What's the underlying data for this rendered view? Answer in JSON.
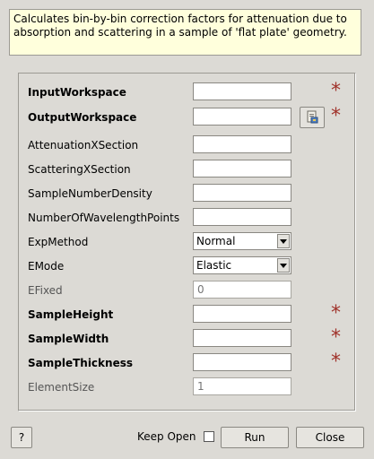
{
  "description": "Calculates bin-by-bin correction factors for attenuation due to absorption and scattering in a sample of 'flat plate' geometry.",
  "properties": [
    {
      "key": "input_workspace",
      "label": "InputWorkspace",
      "value": "",
      "required": true,
      "type": "text",
      "browse": false
    },
    {
      "key": "output_workspace",
      "label": "OutputWorkspace",
      "value": "",
      "required": true,
      "type": "text",
      "browse": true
    },
    {
      "key": "attenuation_xsection",
      "label": "AttenuationXSection",
      "value": "",
      "required": false,
      "type": "text"
    },
    {
      "key": "scattering_xsection",
      "label": "ScatteringXSection",
      "value": "",
      "required": false,
      "type": "text"
    },
    {
      "key": "sample_number_density",
      "label": "SampleNumberDensity",
      "value": "",
      "required": false,
      "type": "text"
    },
    {
      "key": "number_of_wavelength_points",
      "label": "NumberOfWavelengthPoints",
      "value": "",
      "required": false,
      "type": "text"
    },
    {
      "key": "exp_method",
      "label": "ExpMethod",
      "value": "Normal",
      "required": false,
      "type": "select"
    },
    {
      "key": "emode",
      "label": "EMode",
      "value": "Elastic",
      "required": false,
      "type": "select"
    },
    {
      "key": "efixed",
      "label": "EFixed",
      "value": "",
      "placeholder": "0",
      "required": false,
      "type": "text",
      "disabled": true
    },
    {
      "key": "sample_height",
      "label": "SampleHeight",
      "value": "",
      "required": true,
      "type": "text"
    },
    {
      "key": "sample_width",
      "label": "SampleWidth",
      "value": "",
      "required": true,
      "type": "text"
    },
    {
      "key": "sample_thickness",
      "label": "SampleThickness",
      "value": "",
      "required": true,
      "type": "text"
    },
    {
      "key": "element_size",
      "label": "ElementSize",
      "value": "",
      "placeholder": "1",
      "required": false,
      "type": "text",
      "disabled": true
    }
  ],
  "required_marker": "*",
  "buttons": {
    "help": "?",
    "keep_open": "Keep Open",
    "keep_open_checked": false,
    "run": "Run",
    "close": "Close"
  },
  "colors": {
    "background": "#dcdad5",
    "description_bg": "#ffffdc",
    "required_star": "#a0322a"
  }
}
